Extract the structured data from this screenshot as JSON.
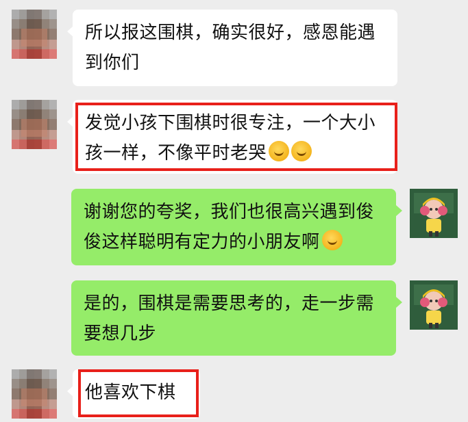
{
  "messages": [
    {
      "id": "m1",
      "side": "left",
      "text": "所以报这围棋，确实很好，感恩能遇到你们"
    },
    {
      "id": "m2",
      "side": "left",
      "text": "发觉小孩下围棋时很专注，一个大小孩一样，不像平时老哭",
      "emoji_count": 2
    },
    {
      "id": "m3",
      "side": "right",
      "text": "谢谢您的夸奖，我们也很高兴遇到俊俊这样聪明有定力的小朋友啊",
      "emoji_count": 1
    },
    {
      "id": "m4",
      "side": "right",
      "text": "是的，围棋是需要思考的，走一步需要想几步"
    },
    {
      "id": "m5",
      "side": "left",
      "text": "他喜欢下棋"
    }
  ],
  "emoji": {
    "name": "thinking-face-icon"
  },
  "colors": {
    "background": "#ededed",
    "incoming_bubble": "#ffffff",
    "outgoing_bubble": "#95ec69",
    "highlight_box": "#e8201a"
  }
}
